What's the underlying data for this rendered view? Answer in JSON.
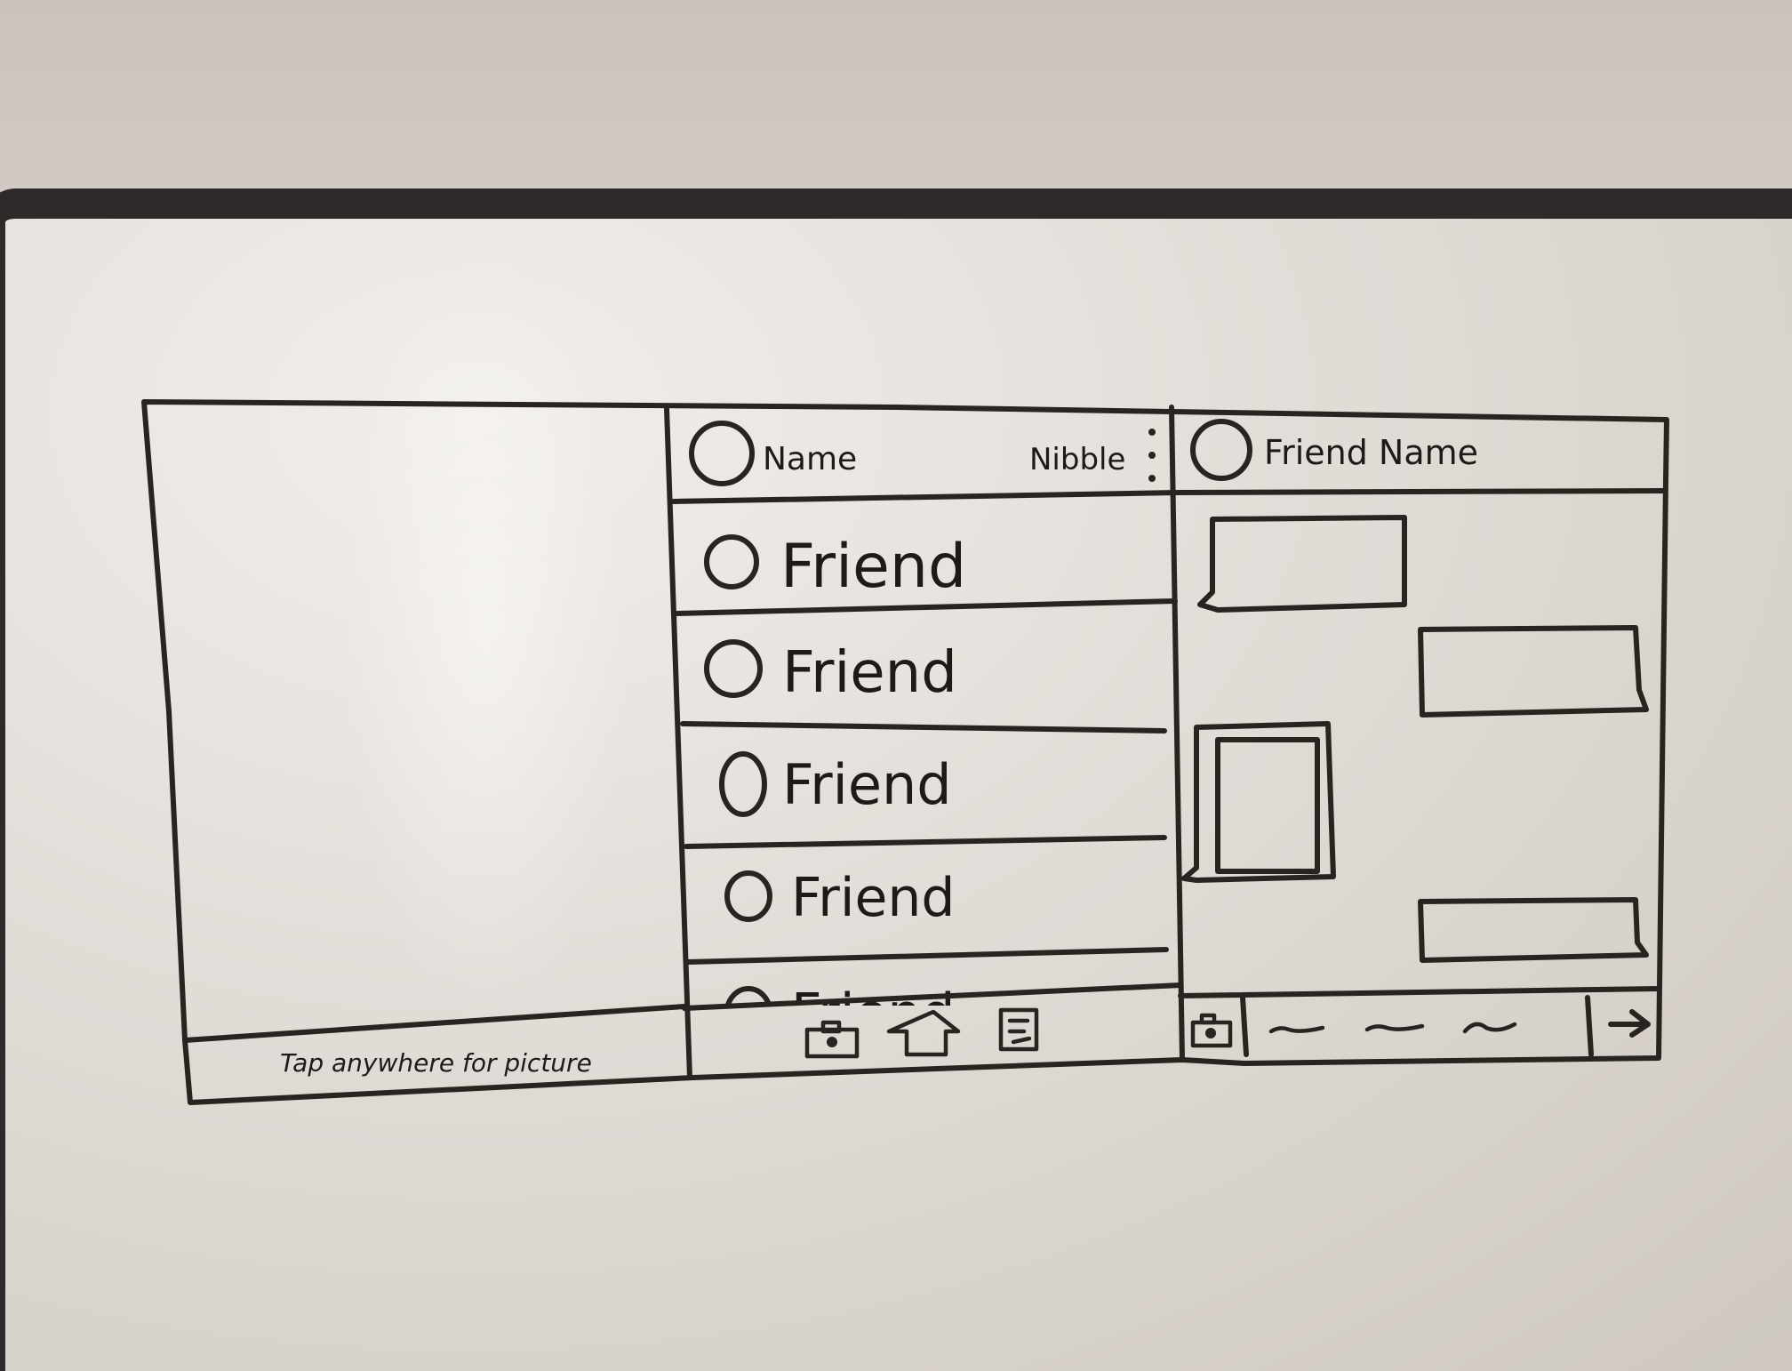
{
  "left_panel": {
    "footer_text": "Tap anywhere for picture"
  },
  "middle_panel": {
    "header": {
      "name": "Name",
      "app_title": "Nibble"
    },
    "friends": [
      "Friend",
      "Friend",
      "Friend",
      "Friend",
      "Friend"
    ],
    "bottom_nav_icons": [
      "camera-icon",
      "home-icon",
      "list-icon"
    ]
  },
  "right_panel": {
    "header": {
      "friend_name": "Friend Name"
    },
    "input_placeholder": "~~ ~~ ~",
    "send_icon": "arrow-right-icon",
    "camera_icon": "camera-icon"
  }
}
